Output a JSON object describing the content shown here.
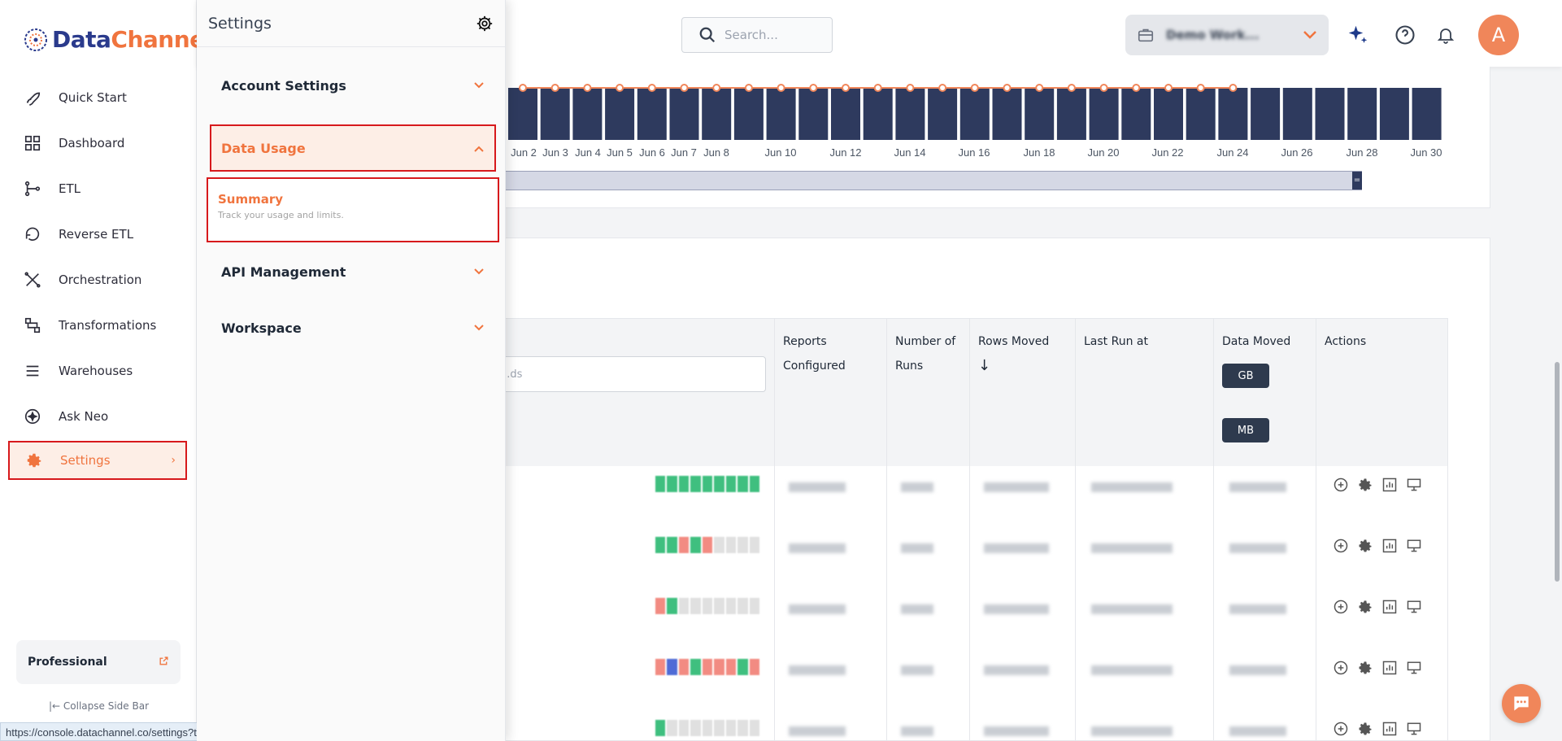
{
  "brand": {
    "name_part1": "Data",
    "name_part2": "Channel"
  },
  "nav": {
    "items": [
      {
        "label": "Quick Start",
        "icon": "rocket-icon"
      },
      {
        "label": "Dashboard",
        "icon": "dashboard-icon"
      },
      {
        "label": "ETL",
        "icon": "etl-icon"
      },
      {
        "label": "Reverse ETL",
        "icon": "reverse-etl-icon"
      },
      {
        "label": "Orchestration",
        "icon": "orchestration-icon"
      },
      {
        "label": "Transformations",
        "icon": "transform-icon"
      },
      {
        "label": "Warehouses",
        "icon": "warehouse-icon"
      },
      {
        "label": "Ask Neo",
        "icon": "neo-icon"
      }
    ],
    "active": {
      "label": "Settings",
      "icon": "gear-icon",
      "chevron": "›"
    },
    "plan": "Professional",
    "collapse": "Collapse Side Bar",
    "status_url": "https://console.datachannel.co/settings?tab=data_usage"
  },
  "settings_panel": {
    "title": "Settings",
    "sections": {
      "account": "Account Settings",
      "data_usage": "Data Usage",
      "api": "API Management",
      "workspace": "Workspace"
    },
    "summary": {
      "title": "Summary",
      "desc": "Track your usage and limits."
    }
  },
  "topbar": {
    "search_placeholder": "Search...",
    "workspace_name": "Demo Work..."
  },
  "chart_data": {
    "type": "bar",
    "x_ticks": [
      "Jun 2",
      "Jun 3",
      "Jun 4",
      "Jun 5",
      "Jun 6",
      "Jun 7",
      "Jun 8",
      "Jun 10",
      "Jun 12",
      "Jun 14",
      "Jun 16",
      "Jun 18",
      "Jun 20",
      "Jun 22",
      "Jun 24",
      "Jun 26",
      "Jun 28",
      "Jun 30"
    ],
    "colors": {
      "bar": "#2e3a5e",
      "line": "#f0865a"
    }
  },
  "table": {
    "filter_placeholder": "...ds",
    "headers": {
      "reports": "Reports Configured",
      "runs": "Number of Runs",
      "rows": "Rows Moved",
      "last_run": "Last Run at",
      "data_moved": "Data Moved",
      "actions": "Actions"
    },
    "sort_arrow": "↓",
    "unit_gb": "GB",
    "unit_mb": "MB"
  }
}
